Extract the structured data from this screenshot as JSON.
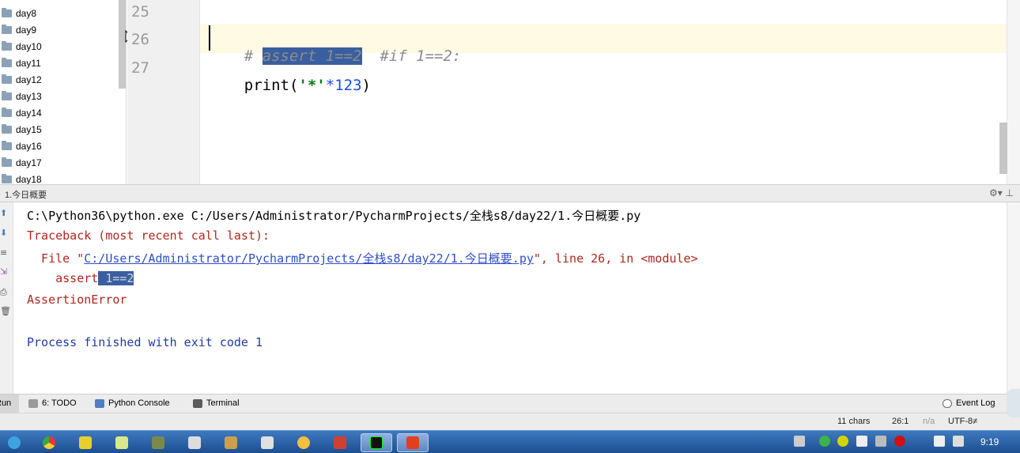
{
  "project_tree": {
    "items": [
      "day8",
      "day9",
      "day10",
      "day11",
      "day12",
      "day13",
      "day14",
      "day15",
      "day16",
      "day17",
      "day18"
    ]
  },
  "editor": {
    "line_numbers": [
      "25",
      "26",
      "27"
    ],
    "line26": {
      "sel1": "assert 1==2",
      "prefix": "# ",
      "comment": "#if 1==2:"
    },
    "line27": {
      "func": "print",
      "open": "(",
      "str": "'*'",
      "mul": "*123",
      "close": ")"
    }
  },
  "run_panel": {
    "title": "1.今日概要",
    "lines": {
      "cmd": "C:\\Python36\\python.exe C:/Users/Administrator/PycharmProjects/全栈s8/day22/1.今日概要.py",
      "traceback": "Traceback (most recent call last):",
      "file_prefix": "  File \"",
      "file_link": "C:/Users/Administrator/PycharmProjects/全栈s8/day22/1.今日概要.py",
      "file_suffix": "\", line 26, in <module>",
      "assert_pre": "    assert",
      "assert_sel": " 1==2",
      "error": "AssertionError",
      "finished": "Process finished with exit code 1"
    }
  },
  "tool_tabs": {
    "run": "Run",
    "todo": "6: TODO",
    "python_console": "Python Console",
    "terminal": "Terminal",
    "event_log": "Event Log"
  },
  "status_bar": {
    "chars": "11 chars",
    "position": "26:1",
    "na": "n/a",
    "encoding": "UTF-8≠"
  },
  "taskbar": {
    "clock": "9:19"
  },
  "colors": {
    "selection": "#3a5fa0",
    "current_line": "#fffae3",
    "error_red": "#b0261e",
    "link_blue": "#2f4fc8"
  }
}
